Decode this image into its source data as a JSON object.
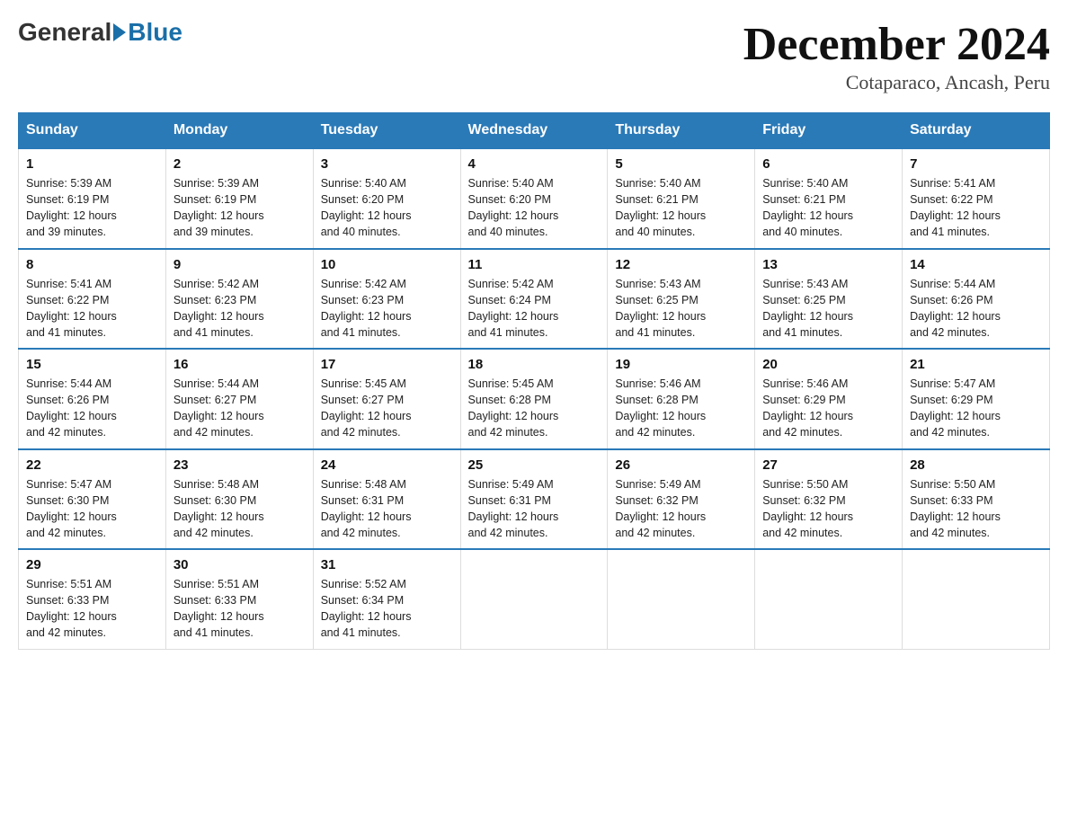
{
  "header": {
    "logo_general": "General",
    "logo_blue": "Blue",
    "title": "December 2024",
    "subtitle": "Cotaparaco, Ancash, Peru"
  },
  "days_of_week": [
    "Sunday",
    "Monday",
    "Tuesday",
    "Wednesday",
    "Thursday",
    "Friday",
    "Saturday"
  ],
  "weeks": [
    [
      {
        "day": "1",
        "sunrise": "5:39 AM",
        "sunset": "6:19 PM",
        "daylight": "12 hours and 39 minutes."
      },
      {
        "day": "2",
        "sunrise": "5:39 AM",
        "sunset": "6:19 PM",
        "daylight": "12 hours and 39 minutes."
      },
      {
        "day": "3",
        "sunrise": "5:40 AM",
        "sunset": "6:20 PM",
        "daylight": "12 hours and 40 minutes."
      },
      {
        "day": "4",
        "sunrise": "5:40 AM",
        "sunset": "6:20 PM",
        "daylight": "12 hours and 40 minutes."
      },
      {
        "day": "5",
        "sunrise": "5:40 AM",
        "sunset": "6:21 PM",
        "daylight": "12 hours and 40 minutes."
      },
      {
        "day": "6",
        "sunrise": "5:40 AM",
        "sunset": "6:21 PM",
        "daylight": "12 hours and 40 minutes."
      },
      {
        "day": "7",
        "sunrise": "5:41 AM",
        "sunset": "6:22 PM",
        "daylight": "12 hours and 41 minutes."
      }
    ],
    [
      {
        "day": "8",
        "sunrise": "5:41 AM",
        "sunset": "6:22 PM",
        "daylight": "12 hours and 41 minutes."
      },
      {
        "day": "9",
        "sunrise": "5:42 AM",
        "sunset": "6:23 PM",
        "daylight": "12 hours and 41 minutes."
      },
      {
        "day": "10",
        "sunrise": "5:42 AM",
        "sunset": "6:23 PM",
        "daylight": "12 hours and 41 minutes."
      },
      {
        "day": "11",
        "sunrise": "5:42 AM",
        "sunset": "6:24 PM",
        "daylight": "12 hours and 41 minutes."
      },
      {
        "day": "12",
        "sunrise": "5:43 AM",
        "sunset": "6:25 PM",
        "daylight": "12 hours and 41 minutes."
      },
      {
        "day": "13",
        "sunrise": "5:43 AM",
        "sunset": "6:25 PM",
        "daylight": "12 hours and 41 minutes."
      },
      {
        "day": "14",
        "sunrise": "5:44 AM",
        "sunset": "6:26 PM",
        "daylight": "12 hours and 42 minutes."
      }
    ],
    [
      {
        "day": "15",
        "sunrise": "5:44 AM",
        "sunset": "6:26 PM",
        "daylight": "12 hours and 42 minutes."
      },
      {
        "day": "16",
        "sunrise": "5:44 AM",
        "sunset": "6:27 PM",
        "daylight": "12 hours and 42 minutes."
      },
      {
        "day": "17",
        "sunrise": "5:45 AM",
        "sunset": "6:27 PM",
        "daylight": "12 hours and 42 minutes."
      },
      {
        "day": "18",
        "sunrise": "5:45 AM",
        "sunset": "6:28 PM",
        "daylight": "12 hours and 42 minutes."
      },
      {
        "day": "19",
        "sunrise": "5:46 AM",
        "sunset": "6:28 PM",
        "daylight": "12 hours and 42 minutes."
      },
      {
        "day": "20",
        "sunrise": "5:46 AM",
        "sunset": "6:29 PM",
        "daylight": "12 hours and 42 minutes."
      },
      {
        "day": "21",
        "sunrise": "5:47 AM",
        "sunset": "6:29 PM",
        "daylight": "12 hours and 42 minutes."
      }
    ],
    [
      {
        "day": "22",
        "sunrise": "5:47 AM",
        "sunset": "6:30 PM",
        "daylight": "12 hours and 42 minutes."
      },
      {
        "day": "23",
        "sunrise": "5:48 AM",
        "sunset": "6:30 PM",
        "daylight": "12 hours and 42 minutes."
      },
      {
        "day": "24",
        "sunrise": "5:48 AM",
        "sunset": "6:31 PM",
        "daylight": "12 hours and 42 minutes."
      },
      {
        "day": "25",
        "sunrise": "5:49 AM",
        "sunset": "6:31 PM",
        "daylight": "12 hours and 42 minutes."
      },
      {
        "day": "26",
        "sunrise": "5:49 AM",
        "sunset": "6:32 PM",
        "daylight": "12 hours and 42 minutes."
      },
      {
        "day": "27",
        "sunrise": "5:50 AM",
        "sunset": "6:32 PM",
        "daylight": "12 hours and 42 minutes."
      },
      {
        "day": "28",
        "sunrise": "5:50 AM",
        "sunset": "6:33 PM",
        "daylight": "12 hours and 42 minutes."
      }
    ],
    [
      {
        "day": "29",
        "sunrise": "5:51 AM",
        "sunset": "6:33 PM",
        "daylight": "12 hours and 42 minutes."
      },
      {
        "day": "30",
        "sunrise": "5:51 AM",
        "sunset": "6:33 PM",
        "daylight": "12 hours and 41 minutes."
      },
      {
        "day": "31",
        "sunrise": "5:52 AM",
        "sunset": "6:34 PM",
        "daylight": "12 hours and 41 minutes."
      },
      null,
      null,
      null,
      null
    ]
  ],
  "labels": {
    "sunrise": "Sunrise:",
    "sunset": "Sunset:",
    "daylight": "Daylight:"
  }
}
